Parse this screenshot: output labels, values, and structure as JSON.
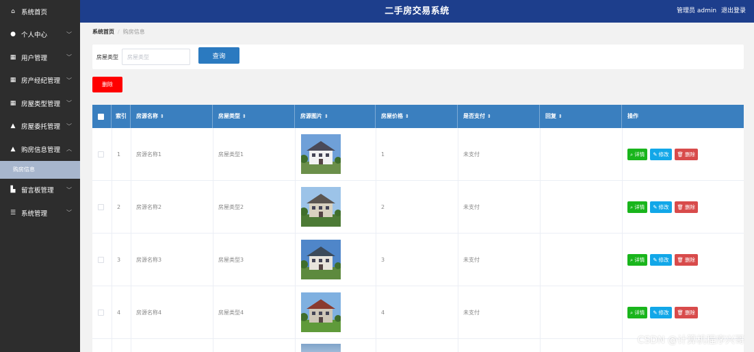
{
  "header": {
    "title": "二手房交易系统",
    "user_label": "管理员 admin",
    "logout_label": "退出登录"
  },
  "sidebar": {
    "items": [
      {
        "label": "系统首页",
        "icon": "home-icon",
        "glyph": "⌂",
        "chevron": ""
      },
      {
        "label": "个人中心",
        "icon": "user-icon",
        "glyph": "●",
        "chevron": "﹀"
      },
      {
        "label": "用户管理",
        "icon": "grid-icon",
        "glyph": "▦",
        "chevron": "﹀"
      },
      {
        "label": "房产经纪管理",
        "icon": "grid-icon",
        "glyph": "▦",
        "chevron": "﹀"
      },
      {
        "label": "房屋类型管理",
        "icon": "grid-icon",
        "glyph": "▦",
        "chevron": "﹀"
      },
      {
        "label": "房屋委托管理",
        "icon": "thumb-icon",
        "glyph": "▲",
        "chevron": "﹀"
      },
      {
        "label": "购房信息管理",
        "icon": "building-icon",
        "glyph": "▲",
        "chevron": "︿"
      }
    ],
    "sub_item": "购房信息",
    "items_after": [
      {
        "label": "留言板管理",
        "icon": "chart-icon",
        "glyph": "▙",
        "chevron": "﹀"
      },
      {
        "label": "系统管理",
        "icon": "sliders-icon",
        "glyph": "☰",
        "chevron": "﹀"
      }
    ]
  },
  "breadcrumb": {
    "home": "系统首页",
    "separator": "/",
    "current": "购房信息"
  },
  "search": {
    "label": "房屋类型",
    "placeholder": "房屋类型",
    "button": "查询"
  },
  "delete_button": "删除",
  "table": {
    "columns": [
      "索引",
      "房源名称",
      "房屋类型",
      "房源图片",
      "房屋价格",
      "是否支付",
      "回复",
      "操作"
    ],
    "sortable": [
      "",
      "⇕",
      "⇕",
      "⇕",
      "⇕",
      "⇕",
      "⇕",
      ""
    ],
    "rows": [
      {
        "index": "1",
        "name": "房源名称1",
        "type": "房屋类型1",
        "price": "1",
        "paid": "未支付",
        "reply": ""
      },
      {
        "index": "2",
        "name": "房源名称2",
        "type": "房屋类型2",
        "price": "2",
        "paid": "未支付",
        "reply": ""
      },
      {
        "index": "3",
        "name": "房源名称3",
        "type": "房屋类型3",
        "price": "3",
        "paid": "未支付",
        "reply": ""
      },
      {
        "index": "4",
        "name": "房源名称4",
        "type": "房屋类型4",
        "price": "4",
        "paid": "未支付",
        "reply": ""
      }
    ],
    "actions": {
      "detail": "详情",
      "edit": "修改",
      "delete": "删除"
    }
  },
  "watermark": "CSDN @计算机程序兴哥",
  "colors": {
    "header": "#1d3e8c",
    "sidebar": "#2d2d2d",
    "table_head": "#3a7fbf",
    "delete": "#ff0000",
    "detail": "#19b51c",
    "edit": "#12a7e8",
    "remove": "#d84b4b"
  }
}
